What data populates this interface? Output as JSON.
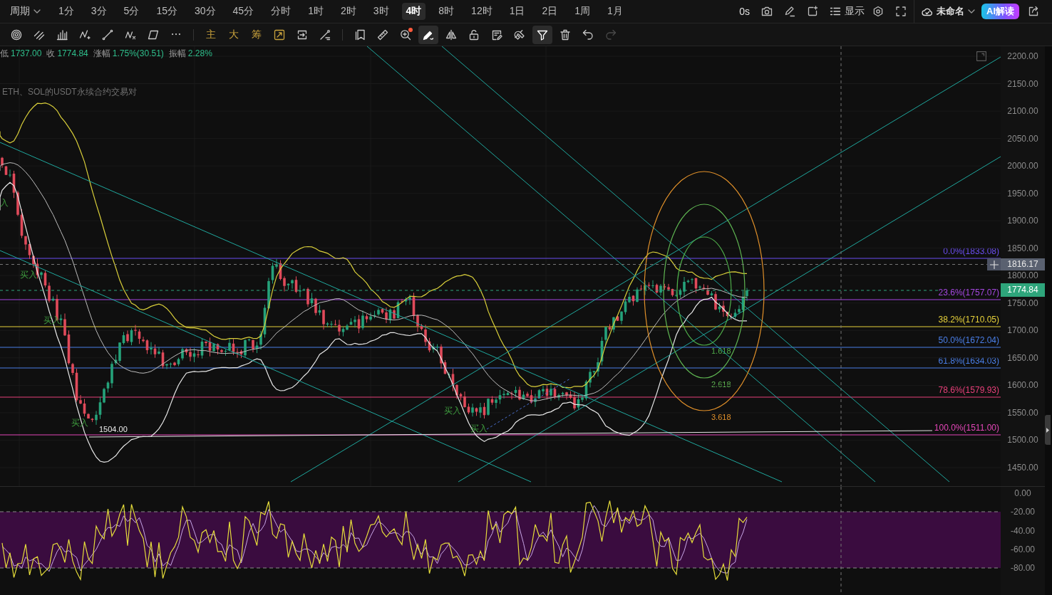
{
  "period_bar": {
    "period_menu": {
      "label": "周期"
    },
    "periods": [
      {
        "label": "1分",
        "selected": false
      },
      {
        "label": "3分",
        "selected": false
      },
      {
        "label": "5分",
        "selected": false
      },
      {
        "label": "15分",
        "selected": false
      },
      {
        "label": "30分",
        "selected": false
      },
      {
        "label": "45分",
        "selected": false
      },
      {
        "label": "分时",
        "selected": false
      },
      {
        "label": "1时",
        "selected": false
      },
      {
        "label": "2时",
        "selected": false
      },
      {
        "label": "3时",
        "selected": false
      },
      {
        "label": "4时",
        "selected": true
      },
      {
        "label": "8时",
        "selected": false
      },
      {
        "label": "12时",
        "selected": false
      },
      {
        "label": "1日",
        "selected": false
      },
      {
        "label": "2日",
        "selected": false
      },
      {
        "label": "1周",
        "selected": false
      },
      {
        "label": "1月",
        "selected": false
      }
    ],
    "countdown": "0s",
    "display_menu": {
      "label": "显示"
    },
    "layout_menu": {
      "label": "未命名"
    },
    "ai_button": {
      "label": "AI解读"
    }
  },
  "drawing_toolbar": {
    "groups": [
      {
        "tools": [
          {
            "kind": "icon",
            "selected": false,
            "disabled": false,
            "badge_dot": false
          },
          {
            "kind": "icon",
            "selected": false,
            "disabled": false,
            "badge_dot": false
          },
          {
            "kind": "icon",
            "selected": false,
            "disabled": false,
            "badge_dot": false
          },
          {
            "kind": "icon",
            "selected": false,
            "disabled": false,
            "badge_dot": false
          },
          {
            "kind": "icon",
            "selected": false,
            "disabled": false,
            "badge_dot": false
          },
          {
            "kind": "icon",
            "selected": false,
            "disabled": false,
            "badge_dot": false
          },
          {
            "kind": "icon",
            "selected": false,
            "disabled": false,
            "badge_dot": false
          },
          {
            "kind": "icon",
            "selected": false,
            "disabled": false,
            "badge_dot": false
          }
        ]
      },
      {
        "tools": [
          {
            "kind": "text",
            "label": "主",
            "selected": false,
            "disabled": false,
            "badge_dot": false
          },
          {
            "kind": "text",
            "label": "大",
            "selected": false,
            "disabled": false,
            "badge_dot": false
          },
          {
            "kind": "text",
            "label": "筹",
            "selected": false,
            "disabled": false,
            "badge_dot": false
          },
          {
            "kind": "icon",
            "selected": false,
            "disabled": false,
            "badge_dot": false
          },
          {
            "kind": "icon",
            "selected": false,
            "disabled": false,
            "badge_dot": false
          },
          {
            "kind": "icon",
            "selected": false,
            "disabled": false,
            "badge_dot": false
          }
        ]
      },
      {
        "tools": [
          {
            "kind": "icon",
            "selected": false,
            "disabled": false,
            "badge_dot": false
          },
          {
            "kind": "icon",
            "selected": false,
            "disabled": false,
            "badge_dot": false
          },
          {
            "kind": "icon",
            "selected": false,
            "disabled": false,
            "badge_dot": true
          },
          {
            "kind": "icon",
            "selected": true,
            "disabled": false,
            "badge_dot": false
          },
          {
            "kind": "icon",
            "selected": false,
            "disabled": false,
            "badge_dot": false
          },
          {
            "kind": "icon",
            "selected": false,
            "disabled": false,
            "badge_dot": false
          },
          {
            "kind": "icon",
            "selected": false,
            "disabled": false,
            "badge_dot": false
          },
          {
            "kind": "icon",
            "selected": false,
            "disabled": false,
            "badge_dot": false
          },
          {
            "kind": "icon",
            "selected": true,
            "disabled": false,
            "badge_dot": false
          },
          {
            "kind": "icon",
            "selected": false,
            "disabled": false,
            "badge_dot": false
          },
          {
            "kind": "icon",
            "selected": false,
            "disabled": false,
            "badge_dot": false
          },
          {
            "kind": "icon",
            "selected": false,
            "disabled": true,
            "badge_dot": false
          }
        ]
      }
    ]
  },
  "price_chart": {
    "ohlc_info": [
      {
        "label": "低",
        "value": "1737.00"
      },
      {
        "label": "收",
        "value": "1774.84"
      },
      {
        "label": "涨幅",
        "value": "1.75%(30.51)"
      },
      {
        "label": "振幅",
        "value": "2.28%"
      }
    ],
    "legend_text": "ETH、SOL的USDT永续合约交易对",
    "signals": [
      {
        "label": "入"
      },
      {
        "label": "买入"
      },
      {
        "label": "买入"
      },
      {
        "label": "买入"
      },
      {
        "label": "买入"
      },
      {
        "label": "买入"
      }
    ],
    "low_marker": "1504.00",
    "fib_levels": [
      {
        "label": "0.0%(1833.08)",
        "color": "#6b4ef2"
      },
      {
        "label": "23.6%(1757.07)",
        "color": "#a447e0"
      },
      {
        "label": "38.2%(1710.05)",
        "color": "#e6d13a"
      },
      {
        "label": "50.0%(1672.04)",
        "color": "#4a7fe8"
      },
      {
        "label": "61.8%(1634.03)",
        "color": "#4a7fe8"
      },
      {
        "label": "78.6%(1579.93)",
        "color": "#e8407a"
      },
      {
        "label": "100.0%(1511.00)",
        "color": "#e447b8"
      }
    ],
    "fib_circles": [
      {
        "label": "1.618",
        "color": "#4fae4a"
      },
      {
        "label": "2.618",
        "color": "#5fb552"
      },
      {
        "label": "3.618",
        "color": "#e0902a"
      }
    ],
    "crosshair_price": "1816.17",
    "current_price": "1774.84",
    "price_axis": [
      "2200.00",
      "2150.00",
      "2100.00",
      "2050.00",
      "2000.00",
      "1950.00",
      "1900.00",
      "1850.00",
      "1800.00",
      "1750.00",
      "1700.00",
      "1650.00",
      "1600.00",
      "1550.00",
      "1500.00",
      "1450.00"
    ]
  },
  "oscillator": {
    "axis": [
      "0.00",
      "-20.00",
      "-40.00",
      "-60.00",
      "-80.00"
    ]
  }
}
